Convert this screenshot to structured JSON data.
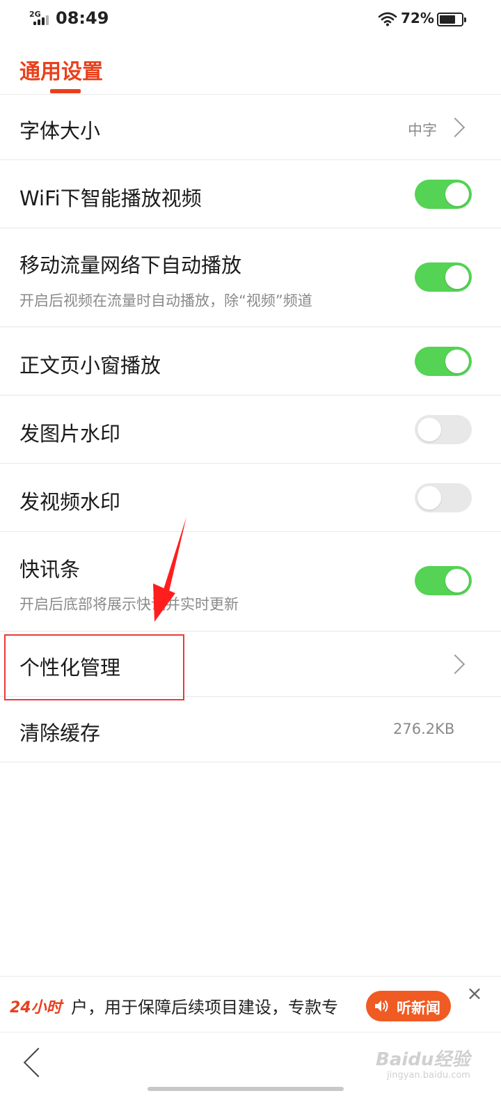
{
  "status_bar": {
    "network": "2G",
    "time": "08:49",
    "battery_percent": "72%",
    "battery_level": 0.72
  },
  "header": {
    "title": "通用设置",
    "accent_color": "#e8401c"
  },
  "settings": {
    "font_size": {
      "label": "字体大小",
      "value": "中字"
    },
    "wifi_autoplay": {
      "label": "WiFi下智能播放视频",
      "enabled": true
    },
    "mobile_autoplay": {
      "label": "移动流量网络下自动播放",
      "description": "开启后视频在流量时自动播放，除“视频”频道",
      "enabled": true
    },
    "article_mini_window": {
      "label": "正文页小窗播放",
      "enabled": true
    },
    "image_watermark": {
      "label": "发图片水印",
      "enabled": false
    },
    "video_watermark": {
      "label": "发视频水印",
      "enabled": false
    },
    "news_flash": {
      "label": "快讯条",
      "description": "开启后底部将展示快讯并实时更新",
      "enabled": true
    },
    "personalization": {
      "label": "个性化管理"
    },
    "clear_cache": {
      "label": "清除缓存",
      "value": "276.2KB"
    }
  },
  "toggle_colors": {
    "on": "#54d354",
    "off": "#e8e8e8"
  },
  "ticker": {
    "logo": "24小时",
    "text": "户，用于保障后续项目建设，专款专",
    "listen_label": "听新闻",
    "close_icon": "close-icon"
  },
  "watermark": {
    "brand": "Baidu经验",
    "url": "jingyan.baidu.com"
  },
  "annotation_color": "#e83a3a"
}
